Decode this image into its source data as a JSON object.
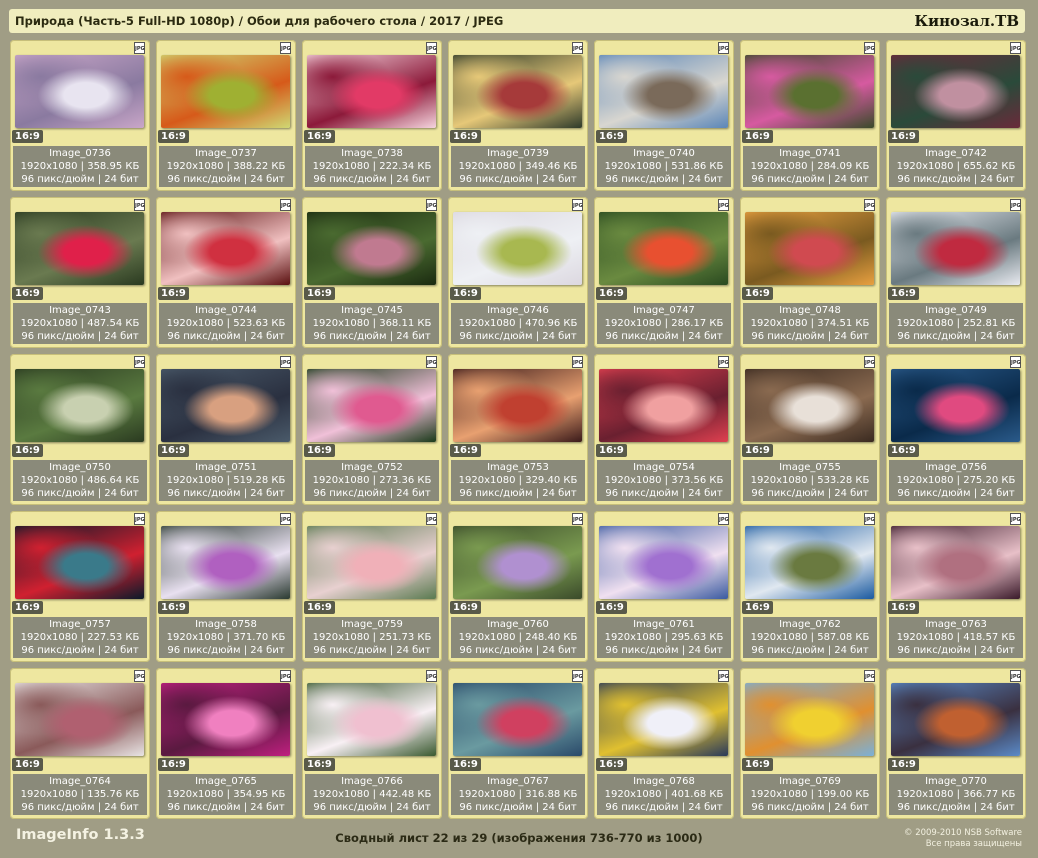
{
  "header": {
    "title": "Природа (Часть-5 Full-HD 1080p) / Обои для рабочего стола / 2017 / JPEG",
    "brand": "Кинозал.ТВ"
  },
  "footer": {
    "app": "ImageInfo 1.3.3",
    "summary": "Сводный лист 22 из 29 (изображения 736-770 из 1000)",
    "copyright": "© 2009-2010 NSB Software",
    "rights": "Все права защищены"
  },
  "card_common": {
    "badge": "JPG",
    "ratio": "16:9",
    "resolution": "1920x1080",
    "dpi_bits": "96 пикс/дюйм | 24 бит"
  },
  "images": [
    {
      "name": "Image_0736",
      "size": "358.95 КБ",
      "colors": [
        "#c9a6c8",
        "#e8e4f0",
        "#8a7aa0"
      ]
    },
    {
      "name": "Image_0737",
      "size": "388.22 КБ",
      "colors": [
        "#cfd873",
        "#9fb032",
        "#d65a1a"
      ]
    },
    {
      "name": "Image_0738",
      "size": "222.34 КБ",
      "colors": [
        "#f5d4de",
        "#e23a66",
        "#8c1a3a"
      ]
    },
    {
      "name": "Image_0739",
      "size": "349.46 КБ",
      "colors": [
        "#2d3a2a",
        "#a63a3a",
        "#e6c878"
      ]
    },
    {
      "name": "Image_0740",
      "size": "531.86 КБ",
      "colors": [
        "#5b86b8",
        "#7a6a5a",
        "#d8d6d0"
      ]
    },
    {
      "name": "Image_0741",
      "size": "284.09 КБ",
      "colors": [
        "#3a4a2a",
        "#5a7030",
        "#d65aa0"
      ]
    },
    {
      "name": "Image_0742",
      "size": "655.62 КБ",
      "colors": [
        "#6a2a3a",
        "#c090a0",
        "#2a4a3a"
      ]
    },
    {
      "name": "Image_0743",
      "size": "487.54 КБ",
      "colors": [
        "#2a3a20",
        "#e0204a",
        "#6a7a50"
      ]
    },
    {
      "name": "Image_0744",
      "size": "523.63 КБ",
      "colors": [
        "#5a1010",
        "#d03040",
        "#f0c0c0"
      ]
    },
    {
      "name": "Image_0745",
      "size": "368.11 КБ",
      "colors": [
        "#1a2a10",
        "#c07a90",
        "#4a6a30"
      ]
    },
    {
      "name": "Image_0746",
      "size": "470.96 КБ",
      "colors": [
        "#dcd8e0",
        "#a8b850",
        "#eef0f4"
      ]
    },
    {
      "name": "Image_0747",
      "size": "286.17 КБ",
      "colors": [
        "#2a4a20",
        "#e85030",
        "#6a8a40"
      ]
    },
    {
      "name": "Image_0748",
      "size": "374.51 КБ",
      "colors": [
        "#e8a040",
        "#d04a50",
        "#7a5a20"
      ]
    },
    {
      "name": "Image_0749",
      "size": "252.81 КБ",
      "colors": [
        "#e8eaf0",
        "#c02a40",
        "#6a7a80"
      ]
    },
    {
      "name": "Image_0750",
      "size": "486.64 КБ",
      "colors": [
        "#2a3a20",
        "#c8d0b0",
        "#5a7a40"
      ]
    },
    {
      "name": "Image_0751",
      "size": "519.28 КБ",
      "colors": [
        "#4a5a6a",
        "#d8a080",
        "#2a3040"
      ]
    },
    {
      "name": "Image_0752",
      "size": "273.36 КБ",
      "colors": [
        "#1a3a1a",
        "#e05a90",
        "#f0c0d8"
      ]
    },
    {
      "name": "Image_0753",
      "size": "329.40 КБ",
      "colors": [
        "#3a1a1a",
        "#c04030",
        "#e8a070"
      ]
    },
    {
      "name": "Image_0754",
      "size": "373.56 КБ",
      "colors": [
        "#e04050",
        "#f0a0a0",
        "#6a2030"
      ]
    },
    {
      "name": "Image_0755",
      "size": "533.28 КБ",
      "colors": [
        "#3a2a20",
        "#e8e0d8",
        "#8a6a50"
      ]
    },
    {
      "name": "Image_0756",
      "size": "275.20 КБ",
      "colors": [
        "#2a5a8a",
        "#e04a80",
        "#0a2a4a"
      ]
    },
    {
      "name": "Image_0757",
      "size": "227.53 КБ",
      "colors": [
        "#0a1a2a",
        "#3a7a8a",
        "#d02030"
      ]
    },
    {
      "name": "Image_0758",
      "size": "371.70 КБ",
      "colors": [
        "#2a3a30",
        "#b060c0",
        "#e8e0f0"
      ]
    },
    {
      "name": "Image_0759",
      "size": "251.73 КБ",
      "colors": [
        "#5a7a50",
        "#f0b0b8",
        "#e8d0d0"
      ]
    },
    {
      "name": "Image_0760",
      "size": "248.40 КБ",
      "colors": [
        "#3a4a2a",
        "#b090d0",
        "#7a9a50"
      ]
    },
    {
      "name": "Image_0761",
      "size": "295.63 КБ",
      "colors": [
        "#3a5aa0",
        "#a070d0",
        "#f0e0f0"
      ]
    },
    {
      "name": "Image_0762",
      "size": "587.08 КБ",
      "colors": [
        "#1a5aa0",
        "#6a7a40",
        "#e0e8f0"
      ]
    },
    {
      "name": "Image_0763",
      "size": "418.57 КБ",
      "colors": [
        "#3a1a2a",
        "#b07080",
        "#e8c0c8"
      ]
    },
    {
      "name": "Image_0764",
      "size": "135.76 КБ",
      "colors": [
        "#e8e4e4",
        "#b06070",
        "#8a5a5a"
      ]
    },
    {
      "name": "Image_0765",
      "size": "354.95 КБ",
      "colors": [
        "#c02080",
        "#f080c0",
        "#5a1a40"
      ]
    },
    {
      "name": "Image_0766",
      "size": "442.48 КБ",
      "colors": [
        "#3a5a30",
        "#f0c0d0",
        "#f8f0f4"
      ]
    },
    {
      "name": "Image_0767",
      "size": "316.88 КБ",
      "colors": [
        "#2a4a6a",
        "#d04060",
        "#6a9aa0"
      ]
    },
    {
      "name": "Image_0768",
      "size": "401.68 КБ",
      "colors": [
        "#2a3a5a",
        "#f0f0f8",
        "#e0c030"
      ]
    },
    {
      "name": "Image_0769",
      "size": "199.00 КБ",
      "colors": [
        "#7ab0d8",
        "#f0d030",
        "#e09030"
      ]
    },
    {
      "name": "Image_0770",
      "size": "366.77 КБ",
      "colors": [
        "#5a8ac8",
        "#c06030",
        "#3a3040"
      ]
    }
  ]
}
